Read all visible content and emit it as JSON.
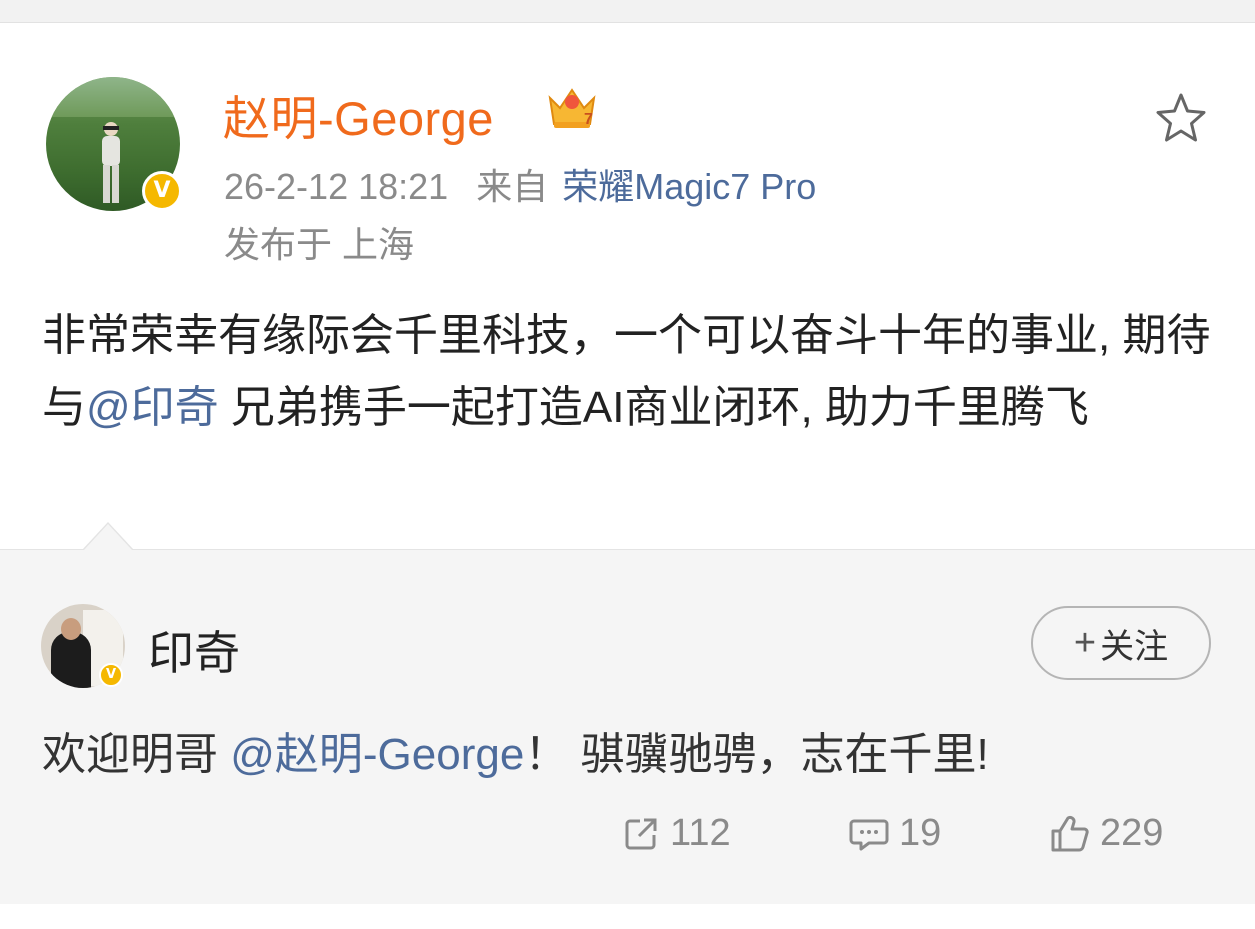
{
  "post": {
    "author": "赵明-George",
    "vip_level": "7",
    "timestamp": "26-2-12 18:21",
    "source_prefix": "来自",
    "source_device": "荣耀Magic7 Pro",
    "location": "发布于 上海",
    "body_part1": "非常荣幸有缘际会千里科技，一个可以奋斗十年的事业, 期待与",
    "body_mention": "@印奇",
    "body_part2": " 兄弟携手一起打造AI商业闭环, 助力千里腾飞",
    "verified_badge": "V"
  },
  "repost": {
    "author": "印奇",
    "follow_label": "关注",
    "text_part1": "欢迎明哥 ",
    "text_mention": "@赵明-George",
    "text_part2": "！ 骐骥驰骋，志在千里!",
    "verified_badge": "V",
    "repost_count": "112",
    "comment_count": "19",
    "like_count": "229"
  },
  "colors": {
    "author_orange": "#f06a1c",
    "mention_blue": "#4d6b9b",
    "verified_gold": "#f5b800"
  },
  "icons": [
    "star-icon",
    "crown-badge-icon",
    "verified-icon",
    "plus-icon",
    "repost-icon",
    "comment-icon",
    "like-icon"
  ]
}
